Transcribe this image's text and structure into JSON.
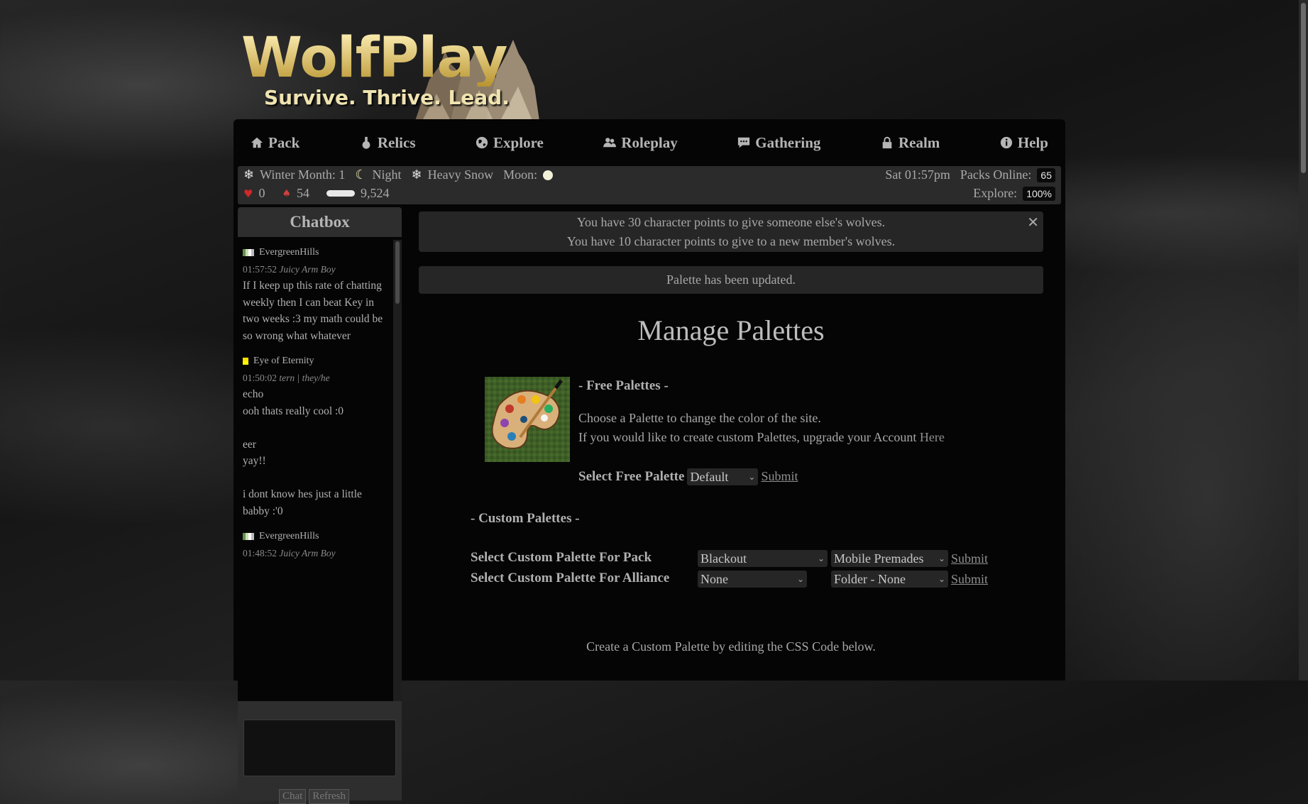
{
  "logo": {
    "title": "WolfPlay",
    "tagline": "Survive. Thrive. Lead."
  },
  "nav": [
    {
      "label": "Pack",
      "icon": "home-icon"
    },
    {
      "label": "Relics",
      "icon": "potion-icon"
    },
    {
      "label": "Explore",
      "icon": "globe-icon"
    },
    {
      "label": "Roleplay",
      "icon": "users-icon"
    },
    {
      "label": "Gathering",
      "icon": "chat-icon"
    },
    {
      "label": "Realm",
      "icon": "lock-icon"
    },
    {
      "label": "Help",
      "icon": "info-icon"
    }
  ],
  "status": {
    "season": "Winter Month: 1",
    "time_of_day": "Night",
    "weather": "Heavy Snow",
    "moon_label": "Moon:",
    "hearts": "0",
    "mushrooms": "54",
    "bones": "9,524",
    "clock": "Sat 01:57pm",
    "packs_online_label": "Packs Online:",
    "packs_online": "65",
    "explore_label": "Explore:",
    "explore_value": "100%"
  },
  "chatbox": {
    "title": "Chatbox",
    "messages": [
      {
        "user": "EvergreenHills",
        "time": "01:57:52",
        "alias": "Juicy Arm Boy",
        "text": "If I keep up this rate of chatting weekly then I can beat Key in two weeks :3 my math could be so wrong what whatever"
      },
      {
        "user": "Eye of Eternity",
        "time": "01:50:02",
        "alias": "tern | they/he",
        "text": "echo\nooh thats really cool :0\n\neer\nyay!!\n\ni dont know hes just a little babby :'0"
      },
      {
        "user": "EvergreenHills",
        "time": "01:48:52",
        "alias": "Juicy Arm Boy",
        "text": ""
      }
    ],
    "chat_button": "Chat",
    "refresh_button": "Refresh"
  },
  "alerts": {
    "points_line1": "You have 30 character points to give someone else's wolves.",
    "points_line2": "You have 10 character points to give to a new member's wolves.",
    "palette_updated": "Palette has been updated."
  },
  "main": {
    "title": "Manage Palettes",
    "free_heading": "- Free Palettes -",
    "free_desc1": "Choose a Palette to change the color of the site.",
    "free_desc2": "If you would like to create custom Palettes, upgrade your Account ",
    "free_desc2_link": "Here",
    "select_free_label": "Select Free Palette",
    "free_selected": "Default",
    "submit": "Submit",
    "custom_heading": "- Custom Palettes -",
    "pack_label": "Select Custom Palette For Pack",
    "pack_selected": "Blackout",
    "pack_folder_selected": "Mobile Premades",
    "alliance_label": "Select Custom Palette For Alliance",
    "alliance_selected": "None",
    "alliance_folder_selected": "Folder - None",
    "css_hint": "Create a Custom Palette by editing the CSS Code below."
  }
}
